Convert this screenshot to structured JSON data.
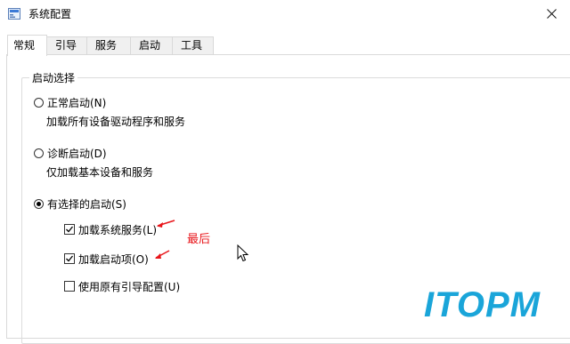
{
  "window": {
    "title": "系统配置"
  },
  "tabs": [
    {
      "label": "常规",
      "active": true
    },
    {
      "label": "引导",
      "active": false
    },
    {
      "label": "服务",
      "active": false
    },
    {
      "label": "启动",
      "active": false
    },
    {
      "label": "工具",
      "active": false
    }
  ],
  "startup_group": {
    "legend": "启动选择",
    "options": [
      {
        "label": "正常启动(N)",
        "description": "加载所有设备驱动程序和服务",
        "selected": false
      },
      {
        "label": "诊断启动(D)",
        "description": "仅加载基本设备和服务",
        "selected": false
      },
      {
        "label": "有选择的启动(S)",
        "selected": true
      }
    ],
    "checkboxes": [
      {
        "label": "加载系统服务(L)",
        "checked": true
      },
      {
        "label": "加载启动项(O)",
        "checked": true
      },
      {
        "label": "使用原有引导配置(U)",
        "checked": false
      }
    ]
  },
  "annotation": {
    "text": "最后",
    "color": "#e8161b"
  },
  "watermark": {
    "text": "ITOPM",
    "color": "#1aa5d9"
  },
  "icons": {
    "app": "system-config-icon",
    "close": "close-icon",
    "cursor": "mouse-pointer-icon"
  }
}
